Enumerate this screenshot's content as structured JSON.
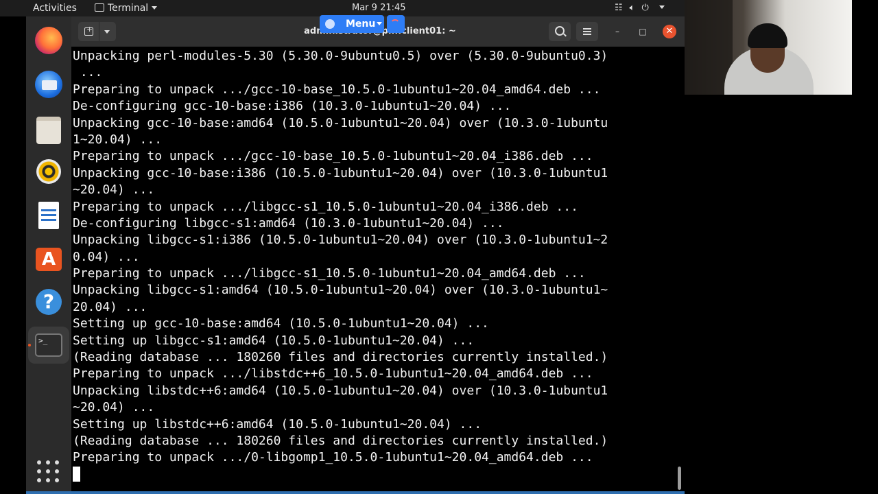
{
  "topbar": {
    "activities": "Activities",
    "app_menu": "Terminal",
    "clock": "Mar 9  21:45",
    "tray_icons": [
      "network-icon",
      "volume-icon",
      "power-icon"
    ]
  },
  "dock": {
    "apps": [
      "Firefox",
      "Thunderbird",
      "Files",
      "Rhythmbox",
      "LibreOffice Writer",
      "Ubuntu Software",
      "Help",
      "Terminal"
    ],
    "terminal_glyph": ">_"
  },
  "software_glyph": "A",
  "help_glyph": "?",
  "window": {
    "title": "administrator@pl...client01: ~"
  },
  "overlay": {
    "menu_label": "Menu"
  },
  "terminal_lines": [
    "Unpacking perl-modules-5.30 (5.30.0-9ubuntu0.5) over (5.30.0-9ubuntu0.3)",
    " ...",
    "Preparing to unpack .../gcc-10-base_10.5.0-1ubuntu1~20.04_amd64.deb ...",
    "De-configuring gcc-10-base:i386 (10.3.0-1ubuntu1~20.04) ...",
    "Unpacking gcc-10-base:amd64 (10.5.0-1ubuntu1~20.04) over (10.3.0-1ubuntu",
    "1~20.04) ...",
    "Preparing to unpack .../gcc-10-base_10.5.0-1ubuntu1~20.04_i386.deb ...",
    "Unpacking gcc-10-base:i386 (10.5.0-1ubuntu1~20.04) over (10.3.0-1ubuntu1",
    "~20.04) ...",
    "Preparing to unpack .../libgcc-s1_10.5.0-1ubuntu1~20.04_i386.deb ...",
    "De-configuring libgcc-s1:amd64 (10.3.0-1ubuntu1~20.04) ...",
    "Unpacking libgcc-s1:i386 (10.5.0-1ubuntu1~20.04) over (10.3.0-1ubuntu1~2",
    "0.04) ...",
    "Preparing to unpack .../libgcc-s1_10.5.0-1ubuntu1~20.04_amd64.deb ...",
    "Unpacking libgcc-s1:amd64 (10.5.0-1ubuntu1~20.04) over (10.3.0-1ubuntu1~",
    "20.04) ...",
    "Setting up gcc-10-base:amd64 (10.5.0-1ubuntu1~20.04) ...",
    "Setting up libgcc-s1:amd64 (10.5.0-1ubuntu1~20.04) ...",
    "(Reading database ... 180260 files and directories currently installed.)",
    "Preparing to unpack .../libstdc++6_10.5.0-1ubuntu1~20.04_amd64.deb ...",
    "Unpacking libstdc++6:amd64 (10.5.0-1ubuntu1~20.04) over (10.3.0-1ubuntu1",
    "~20.04) ...",
    "Setting up libstdc++6:amd64 (10.5.0-1ubuntu1~20.04) ...",
    "(Reading database ... 180260 files and directories currently installed.)",
    "Preparing to unpack .../0-libgomp1_10.5.0-1ubuntu1~20.04_amd64.deb ..."
  ],
  "colors": {
    "terminal_bg": "#000000",
    "terminal_fg": "#f2f2f2",
    "close_button": "#e9532f",
    "accent": "#2e7df6"
  }
}
